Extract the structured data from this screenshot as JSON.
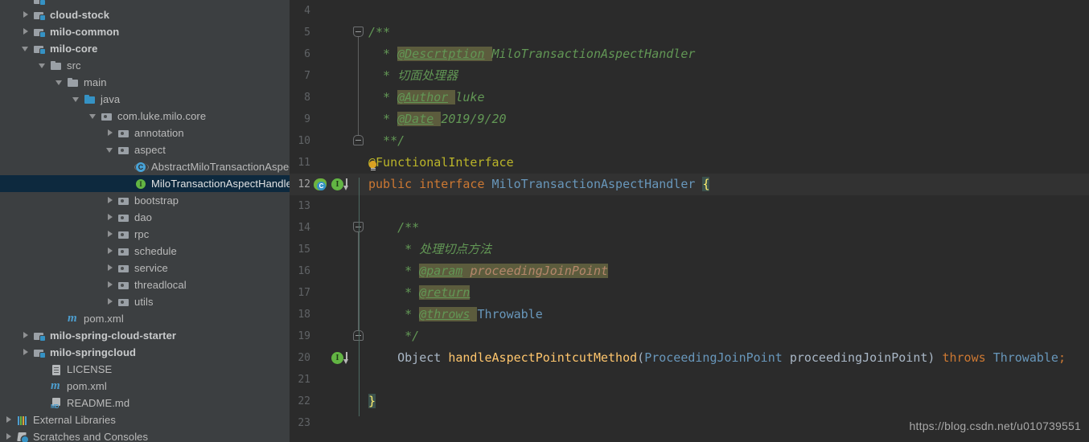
{
  "sidebar": {
    "name": "project-tree",
    "items": [
      {
        "label": "",
        "icon": "module-icon",
        "indent": 1,
        "twisty": "none",
        "bold": true,
        "selected": false,
        "partial": true
      },
      {
        "label": "cloud-stock",
        "icon": "module-icon",
        "indent": 1,
        "twisty": "collapsed",
        "bold": true,
        "selected": false
      },
      {
        "label": "milo-common",
        "icon": "module-icon",
        "indent": 1,
        "twisty": "collapsed",
        "bold": true,
        "selected": false
      },
      {
        "label": "milo-core",
        "icon": "module-icon",
        "indent": 1,
        "twisty": "expanded",
        "bold": true,
        "selected": false
      },
      {
        "label": "src",
        "icon": "folder-icon",
        "indent": 2,
        "twisty": "expanded",
        "bold": false,
        "selected": false
      },
      {
        "label": "main",
        "icon": "folder-icon",
        "indent": 3,
        "twisty": "expanded",
        "bold": false,
        "selected": false
      },
      {
        "label": "java",
        "icon": "source-folder-icon",
        "indent": 4,
        "twisty": "expanded",
        "bold": false,
        "selected": false
      },
      {
        "label": "com.luke.milo.core",
        "icon": "package-icon",
        "indent": 5,
        "twisty": "expanded",
        "bold": false,
        "selected": false
      },
      {
        "label": "annotation",
        "icon": "package-icon",
        "indent": 6,
        "twisty": "collapsed",
        "bold": false,
        "selected": false
      },
      {
        "label": "aspect",
        "icon": "package-icon",
        "indent": 6,
        "twisty": "expanded",
        "bold": false,
        "selected": false
      },
      {
        "label": "AbstractMiloTransactionAspect",
        "icon": "class-icon",
        "indent": 7,
        "twisty": "none",
        "bold": false,
        "selected": false
      },
      {
        "label": "MiloTransactionAspectHandler",
        "icon": "interface-icon",
        "indent": 7,
        "twisty": "none",
        "bold": false,
        "selected": true
      },
      {
        "label": "bootstrap",
        "icon": "package-icon",
        "indent": 6,
        "twisty": "collapsed",
        "bold": false,
        "selected": false
      },
      {
        "label": "dao",
        "icon": "package-icon",
        "indent": 6,
        "twisty": "collapsed",
        "bold": false,
        "selected": false
      },
      {
        "label": "rpc",
        "icon": "package-icon",
        "indent": 6,
        "twisty": "collapsed",
        "bold": false,
        "selected": false
      },
      {
        "label": "schedule",
        "icon": "package-icon",
        "indent": 6,
        "twisty": "collapsed",
        "bold": false,
        "selected": false
      },
      {
        "label": "service",
        "icon": "package-icon",
        "indent": 6,
        "twisty": "collapsed",
        "bold": false,
        "selected": false
      },
      {
        "label": "threadlocal",
        "icon": "package-icon",
        "indent": 6,
        "twisty": "collapsed",
        "bold": false,
        "selected": false
      },
      {
        "label": "utils",
        "icon": "package-icon",
        "indent": 6,
        "twisty": "collapsed",
        "bold": false,
        "selected": false
      },
      {
        "label": "pom.xml",
        "icon": "maven-icon",
        "indent": 3,
        "twisty": "none",
        "bold": false,
        "selected": false
      },
      {
        "label": "milo-spring-cloud-starter",
        "icon": "module-icon",
        "indent": 1,
        "twisty": "collapsed",
        "bold": true,
        "selected": false
      },
      {
        "label": "milo-springcloud",
        "icon": "module-icon",
        "indent": 1,
        "twisty": "collapsed",
        "bold": true,
        "selected": false
      },
      {
        "label": "LICENSE",
        "icon": "file-icon",
        "indent": 2,
        "twisty": "none",
        "bold": false,
        "selected": false
      },
      {
        "label": "pom.xml",
        "icon": "maven-icon",
        "indent": 2,
        "twisty": "none",
        "bold": false,
        "selected": false
      },
      {
        "label": "README.md",
        "icon": "markdown-icon",
        "indent": 2,
        "twisty": "none",
        "bold": false,
        "selected": false
      },
      {
        "label": "External Libraries",
        "icon": "libraries-icon",
        "indent": 0,
        "twisty": "collapsed",
        "bold": false,
        "selected": false
      },
      {
        "label": "Scratches and Consoles",
        "icon": "scratches-icon",
        "indent": 0,
        "twisty": "collapsed",
        "bold": false,
        "selected": false
      }
    ]
  },
  "editor": {
    "name": "code-editor",
    "file": "MiloTransactionAspectHandler",
    "first_line_number": 4,
    "last_line_number": 23,
    "caret_line": 12,
    "lines": [
      {
        "num": 4,
        "fold": "none",
        "text": ""
      },
      {
        "num": 5,
        "fold": "open",
        "text": "/**"
      },
      {
        "num": 6,
        "fold": "bar",
        "text": " * @Descrtption MiloTransactionAspectHandler"
      },
      {
        "num": 7,
        "fold": "bar",
        "text": " * 切面处理器"
      },
      {
        "num": 8,
        "fold": "bar",
        "text": " * @Author luke"
      },
      {
        "num": 9,
        "fold": "bar",
        "text": " * @Date 2019/9/20"
      },
      {
        "num": 10,
        "fold": "close",
        "text": " **/"
      },
      {
        "num": 11,
        "fold": "none",
        "text": "@FunctionalInterface"
      },
      {
        "num": 12,
        "fold": "none",
        "text": "public interface MiloTransactionAspectHandler {"
      },
      {
        "num": 13,
        "fold": "none",
        "text": ""
      },
      {
        "num": 14,
        "fold": "open",
        "text": "    /**"
      },
      {
        "num": 15,
        "fold": "bar",
        "text": "     * 处理切点方法"
      },
      {
        "num": 16,
        "fold": "bar",
        "text": "     * @param proceedingJoinPoint"
      },
      {
        "num": 17,
        "fold": "bar",
        "text": "     * @return"
      },
      {
        "num": 18,
        "fold": "bar",
        "text": "     * @throws Throwable"
      },
      {
        "num": 19,
        "fold": "close",
        "text": "     */"
      },
      {
        "num": 20,
        "fold": "none",
        "text": "    Object handleAspectPointcutMethod(ProceedingJoinPoint proceedingJoinPoint) throws Throwable;"
      },
      {
        "num": 21,
        "fold": "none",
        "text": ""
      },
      {
        "num": 22,
        "fold": "none",
        "text": "}"
      },
      {
        "num": 23,
        "fold": "none",
        "text": ""
      }
    ],
    "tokens": {
      "comment_open": "/**",
      "comment_star": " * ",
      "tag_description": "@Descrtption",
      "tag_description_value": "MiloTransactionAspectHandler",
      "comment_chinese_class": "切面处理器",
      "tag_author": "@Author",
      "tag_author_value": "luke",
      "tag_date": "@Date",
      "tag_date_value": "2019/9/20",
      "comment_close_class": " **/",
      "annotation": "@FunctionalInterface",
      "kw_public": "public",
      "kw_interface": "interface",
      "type_name": "MiloTransactionAspectHandler",
      "brace_open": "{",
      "brace_close": "}",
      "inner_comment_open": "/**",
      "comment_chinese_method": "处理切点方法",
      "tag_param": "@param",
      "tag_param_value": "proceedingJoinPoint",
      "tag_return": "@return",
      "tag_throws": "@throws",
      "tag_throws_value": "Throwable",
      "inner_comment_close": "*/",
      "ret_object": "Object",
      "method_name": "handleAspectPointcutMethod",
      "paren_open": "(",
      "param_type": "ProceedingJoinPoint",
      "param_name": "proceedingJoinPoint",
      "paren_close": ")",
      "kw_throws": "throws",
      "throw_type": "Throwable",
      "semicolon": ";"
    },
    "gutter_icons": [
      {
        "line": 12,
        "icons": [
          "spring-bean-icon",
          "implemented-interface-icon",
          "implemented-arrow-icon"
        ]
      },
      {
        "line": 20,
        "icons": [
          "implemented-method-icon",
          "implemented-arrow-icon"
        ]
      }
    ],
    "intention_bulb_line": 11
  },
  "watermark": {
    "text": "https://blog.csdn.net/u010739551"
  },
  "colors": {
    "sidebar_bg": "#3c3f41",
    "editor_bg": "#2b2b2b",
    "caret_line_bg": "#323232",
    "selection_bg": "#0d293e",
    "comment_green": "#629755",
    "javadoc_tag_bg": "#5c5c3d",
    "keyword_orange": "#cc7832",
    "class_blue": "#6897bb",
    "method_yellow": "#ffc66d",
    "annotation_yellow": "#bbb529",
    "default_text": "#a9b7c6",
    "line_number": "#606366",
    "brace_match_bg": "#3b514d",
    "indent_guide": "#4e6b63"
  }
}
